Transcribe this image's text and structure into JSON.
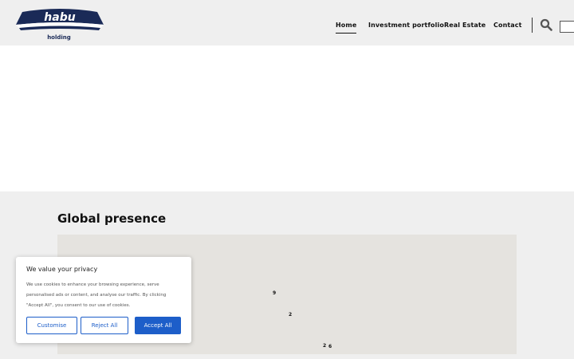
{
  "header": {
    "logo_text": "habu",
    "logo_subtext": "holding",
    "nav": [
      {
        "label": "Home",
        "active": true
      },
      {
        "label": "Investment portfolio",
        "active": false
      },
      {
        "label": "Real Estate",
        "active": false
      },
      {
        "label": "Contact",
        "active": false
      }
    ],
    "search": {
      "icon": "search-icon",
      "value": ""
    }
  },
  "presence": {
    "title": "Global presence",
    "markers": [
      "9",
      "2",
      "2",
      "6"
    ]
  },
  "cookie": {
    "title": "We value your privacy",
    "text": "We use cookies to enhance your browsing experience, serve personalised ads or content, and analyse our traffic. By clicking \"Accept All\", you consent to our use of cookies.",
    "customise_label": "Customise",
    "reject_label": "Reject All",
    "accept_label": "Accept All"
  },
  "colors": {
    "accent": "#1d5ec9",
    "header_bg": "#efefef",
    "logo_navy": "#1a2a57",
    "map_bg": "#e5e3df"
  }
}
